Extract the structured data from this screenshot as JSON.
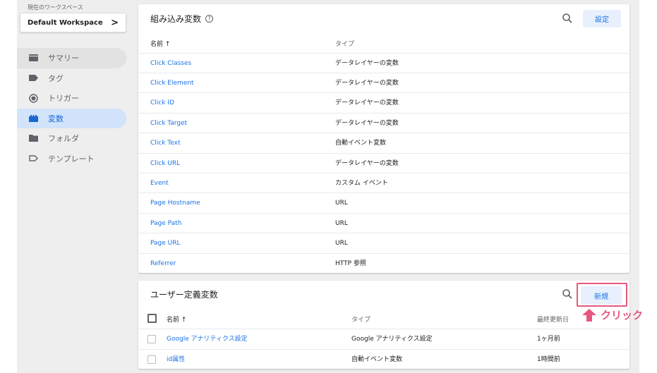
{
  "workspace": {
    "label": "現在のワークスペース",
    "name": "Default Workspace",
    "chevron": ">"
  },
  "sidebar": {
    "items": [
      {
        "label": "サマリー",
        "icon": "summary-icon",
        "state": "hover"
      },
      {
        "label": "タグ",
        "icon": "tag-icon",
        "state": ""
      },
      {
        "label": "トリガー",
        "icon": "trigger-icon",
        "state": ""
      },
      {
        "label": "変数",
        "icon": "variables-icon",
        "state": "active"
      },
      {
        "label": "フォルダ",
        "icon": "folder-icon",
        "state": ""
      },
      {
        "label": "テンプレート",
        "icon": "template-icon",
        "state": ""
      }
    ]
  },
  "builtin": {
    "title": "組み込み変数",
    "help": "?",
    "config_button": "設定",
    "columns": {
      "name": "名前 ↑",
      "type": "タイプ"
    },
    "rows": [
      {
        "name": "Click Classes",
        "type": "データレイヤーの変数"
      },
      {
        "name": "Click Element",
        "type": "データレイヤーの変数"
      },
      {
        "name": "Click ID",
        "type": "データレイヤーの変数"
      },
      {
        "name": "Click Target",
        "type": "データレイヤーの変数"
      },
      {
        "name": "Click Text",
        "type": "自動イベント変数"
      },
      {
        "name": "Click URL",
        "type": "データレイヤーの変数"
      },
      {
        "name": "Event",
        "type": "カスタム イベント"
      },
      {
        "name": "Page Hostname",
        "type": "URL"
      },
      {
        "name": "Page Path",
        "type": "URL"
      },
      {
        "name": "Page URL",
        "type": "URL"
      },
      {
        "name": "Referrer",
        "type": "HTTP 参照"
      }
    ]
  },
  "user_defined": {
    "title": "ユーザー定義変数",
    "new_button": "新規",
    "columns": {
      "name": "名前 ↑",
      "type": "タイプ",
      "updated": "最終更新日"
    },
    "rows": [
      {
        "name": "Google アナリティクス設定",
        "type": "Google アナリティクス設定",
        "updated": "1ヶ月前"
      },
      {
        "name": "id属性",
        "type": "自動イベント変数",
        "updated": "1時間前"
      }
    ]
  },
  "annotation": {
    "text": "クリック"
  },
  "colors": {
    "accent": "#1a73e8",
    "highlight": "#e8577d",
    "active_nav": "#d2e3fc"
  }
}
